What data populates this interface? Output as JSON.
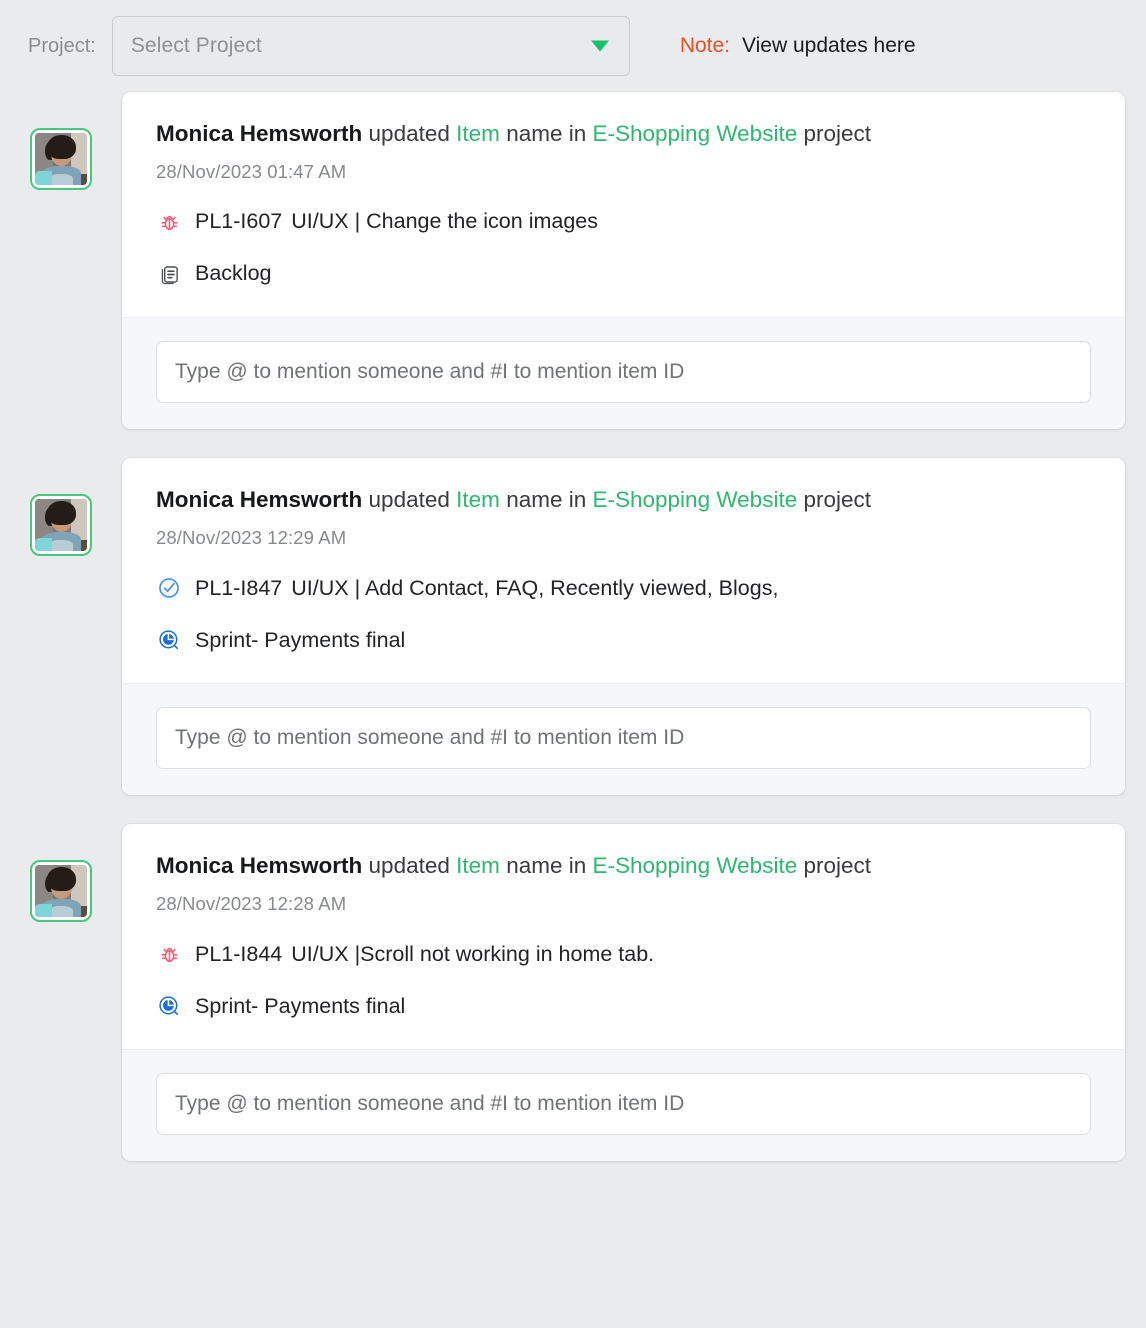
{
  "toolbar": {
    "project_label": "Project:",
    "project_select_placeholder": "Select Project",
    "caret_icon": "chevron-down-icon",
    "note_key": "Note:",
    "note_value": "View updates here",
    "note_color": "#ea5024",
    "accent_green": "#2fb772"
  },
  "feed": {
    "comment_placeholder": "Type @ to mention someone and #I to mention item ID",
    "items": [
      {
        "avatar_alt": "Monica Hemsworth",
        "actor": "Monica Hemsworth",
        "verb": "updated",
        "object": "Item",
        "middle": "name in",
        "project": "E-Shopping Website",
        "suffix": "project",
        "timestamp": "28/Nov/2023 01:47 AM",
        "item_icon": "bug-icon",
        "item_icon_color": "#f2617a",
        "item_id": "PL1-I607",
        "item_title": "UI/UX | Change the icon images",
        "container_icon": "backlog-icon",
        "container_icon_color": "#4d5055",
        "container_label": "Backlog",
        "comment_value": ""
      },
      {
        "avatar_alt": "Monica Hemsworth",
        "actor": "Monica Hemsworth",
        "verb": "updated",
        "object": "Item",
        "middle": "name in",
        "project": "E-Shopping Website",
        "suffix": "project",
        "timestamp": "28/Nov/2023 12:29 AM",
        "item_icon": "task-check-icon",
        "item_icon_color": "#3d8ef0",
        "item_id": "PL1-I847",
        "item_title": "UI/UX | Add Contact, FAQ, Recently viewed, Blogs,",
        "container_icon": "sprint-icon",
        "container_icon_color": "#1b6fd4",
        "container_label": "Sprint- Payments final",
        "comment_value": ""
      },
      {
        "avatar_alt": "Monica Hemsworth",
        "actor": "Monica Hemsworth",
        "verb": "updated",
        "object": "Item",
        "middle": "name in",
        "project": "E-Shopping Website",
        "suffix": "project",
        "timestamp": "28/Nov/2023 12:28 AM",
        "item_icon": "bug-icon",
        "item_icon_color": "#f2617a",
        "item_id": "PL1-I844",
        "item_title": "UI/UX |Scroll not working in home tab.",
        "container_icon": "sprint-icon",
        "container_icon_color": "#1b6fd4",
        "container_label": "Sprint- Payments final",
        "comment_value": ""
      }
    ]
  }
}
